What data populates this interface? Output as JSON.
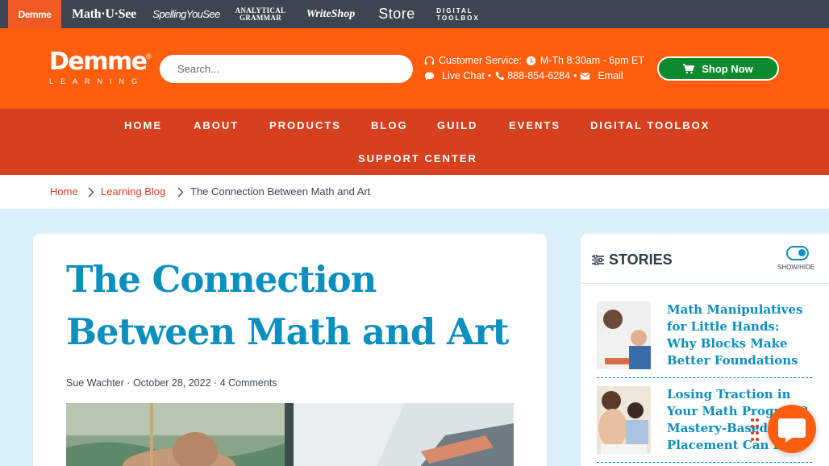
{
  "brand_bar": {
    "items": [
      {
        "label": "Demme"
      },
      {
        "label": "Math·U·See"
      },
      {
        "label": "SpellingYouSee"
      },
      {
        "line1": "ANALYTICAL",
        "line2": "GRAMMAR"
      },
      {
        "label": "WriteShop"
      },
      {
        "label": "Store"
      },
      {
        "line1": "DIGITAL",
        "line2": "TOOLBOX"
      }
    ]
  },
  "header": {
    "logo": {
      "word": "Demme",
      "sub": "LEARNING",
      "mark": "®"
    },
    "search": {
      "placeholder": "Search..."
    },
    "customer_service": {
      "label": "Customer Service:",
      "hours": "M-Th 8:30am - 6pm ET",
      "live_chat": "Live Chat",
      "bullet": "•",
      "phone": "888-854-6284",
      "email": "Email"
    },
    "shop_button": "Shop Now"
  },
  "nav": {
    "items": [
      "HOME",
      "ABOUT",
      "PRODUCTS",
      "BLOG",
      "GUILD",
      "EVENTS",
      "DIGITAL TOOLBOX",
      "SUPPORT CENTER"
    ]
  },
  "breadcrumb": [
    "Home",
    "Learning Blog",
    "The Connection Between Math and Art"
  ],
  "article": {
    "title": "The Connection Between Math and Art",
    "author": "Sue Wachter",
    "date": "October 28, 2022",
    "comments": "4 Comments",
    "dot": "·"
  },
  "sidebar": {
    "heading": "STORIES",
    "toggle_label": "SHOW/HIDE",
    "stories": [
      {
        "title": "Math Manipulatives for Little Hands: Why Blocks Make Better Foundations"
      },
      {
        "title": "Losing Traction in Your Math Program? Mastery-Based Placement Can Help"
      }
    ]
  },
  "colors": {
    "brand_orange": "#ff5e0e",
    "nav_red": "#d6401e",
    "title_blue": "#0b8fbf",
    "shop_green": "#0e8a2e",
    "page_bg": "#d9f0fa"
  }
}
